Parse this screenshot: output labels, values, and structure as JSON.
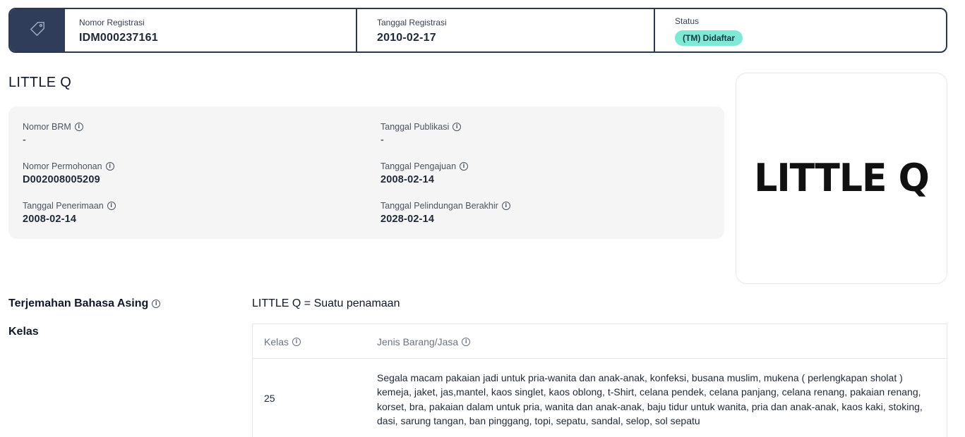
{
  "header": {
    "icon": "tag-icon",
    "registration_number_label": "Nomor Registrasi",
    "registration_number": "IDM000237161",
    "registration_date_label": "Tanggal Registrasi",
    "registration_date": "2010-02-17",
    "status_label": "Status",
    "status": "(TM) Didaftar",
    "status_color": "#7ee9d4"
  },
  "title": "LITTLE Q",
  "details": {
    "brm_label": "Nomor BRM",
    "brm_value": "-",
    "publication_date_label": "Tanggal Publikasi",
    "publication_date_value": "-",
    "application_number_label": "Nomor Permohonan",
    "application_number_value": "D002008005209",
    "filing_date_label": "Tanggal Pengajuan",
    "filing_date_value": "2008-02-14",
    "receipt_date_label": "Tanggal Penerimaan",
    "receipt_date_value": "2008-02-14",
    "protection_end_label": "Tanggal Pelindungan Berakhir",
    "protection_end_value": "2028-02-14"
  },
  "logo": {
    "text": "LITTLE Q"
  },
  "translation": {
    "label": "Terjemahan Bahasa Asing",
    "value": "LITTLE Q = Suatu penamaan"
  },
  "classes": {
    "label": "Kelas",
    "col_class": "Kelas",
    "col_goods": "Jenis Barang/Jasa",
    "rows": [
      {
        "class": "25",
        "goods": "Segala macam pakaian jadi untuk pria-wanita dan anak-anak, konfeksi, busana muslim, mukena ( perlengkapan sholat ) kemeja, jaket, jas,mantel, kaos singlet, kaos oblong, t-Shirt, celana pendek, celana panjang, celana renang, pakaian renang, korset, bra, pakaian dalam untuk pria, wanita dan anak-anak, baju tidur untuk wanita, pria dan anak-anak, kaos kaki, stoking, dasi, sarung tangan, ban pinggang, topi, sepatu, sandal, selop, sol sepatu"
      }
    ]
  }
}
